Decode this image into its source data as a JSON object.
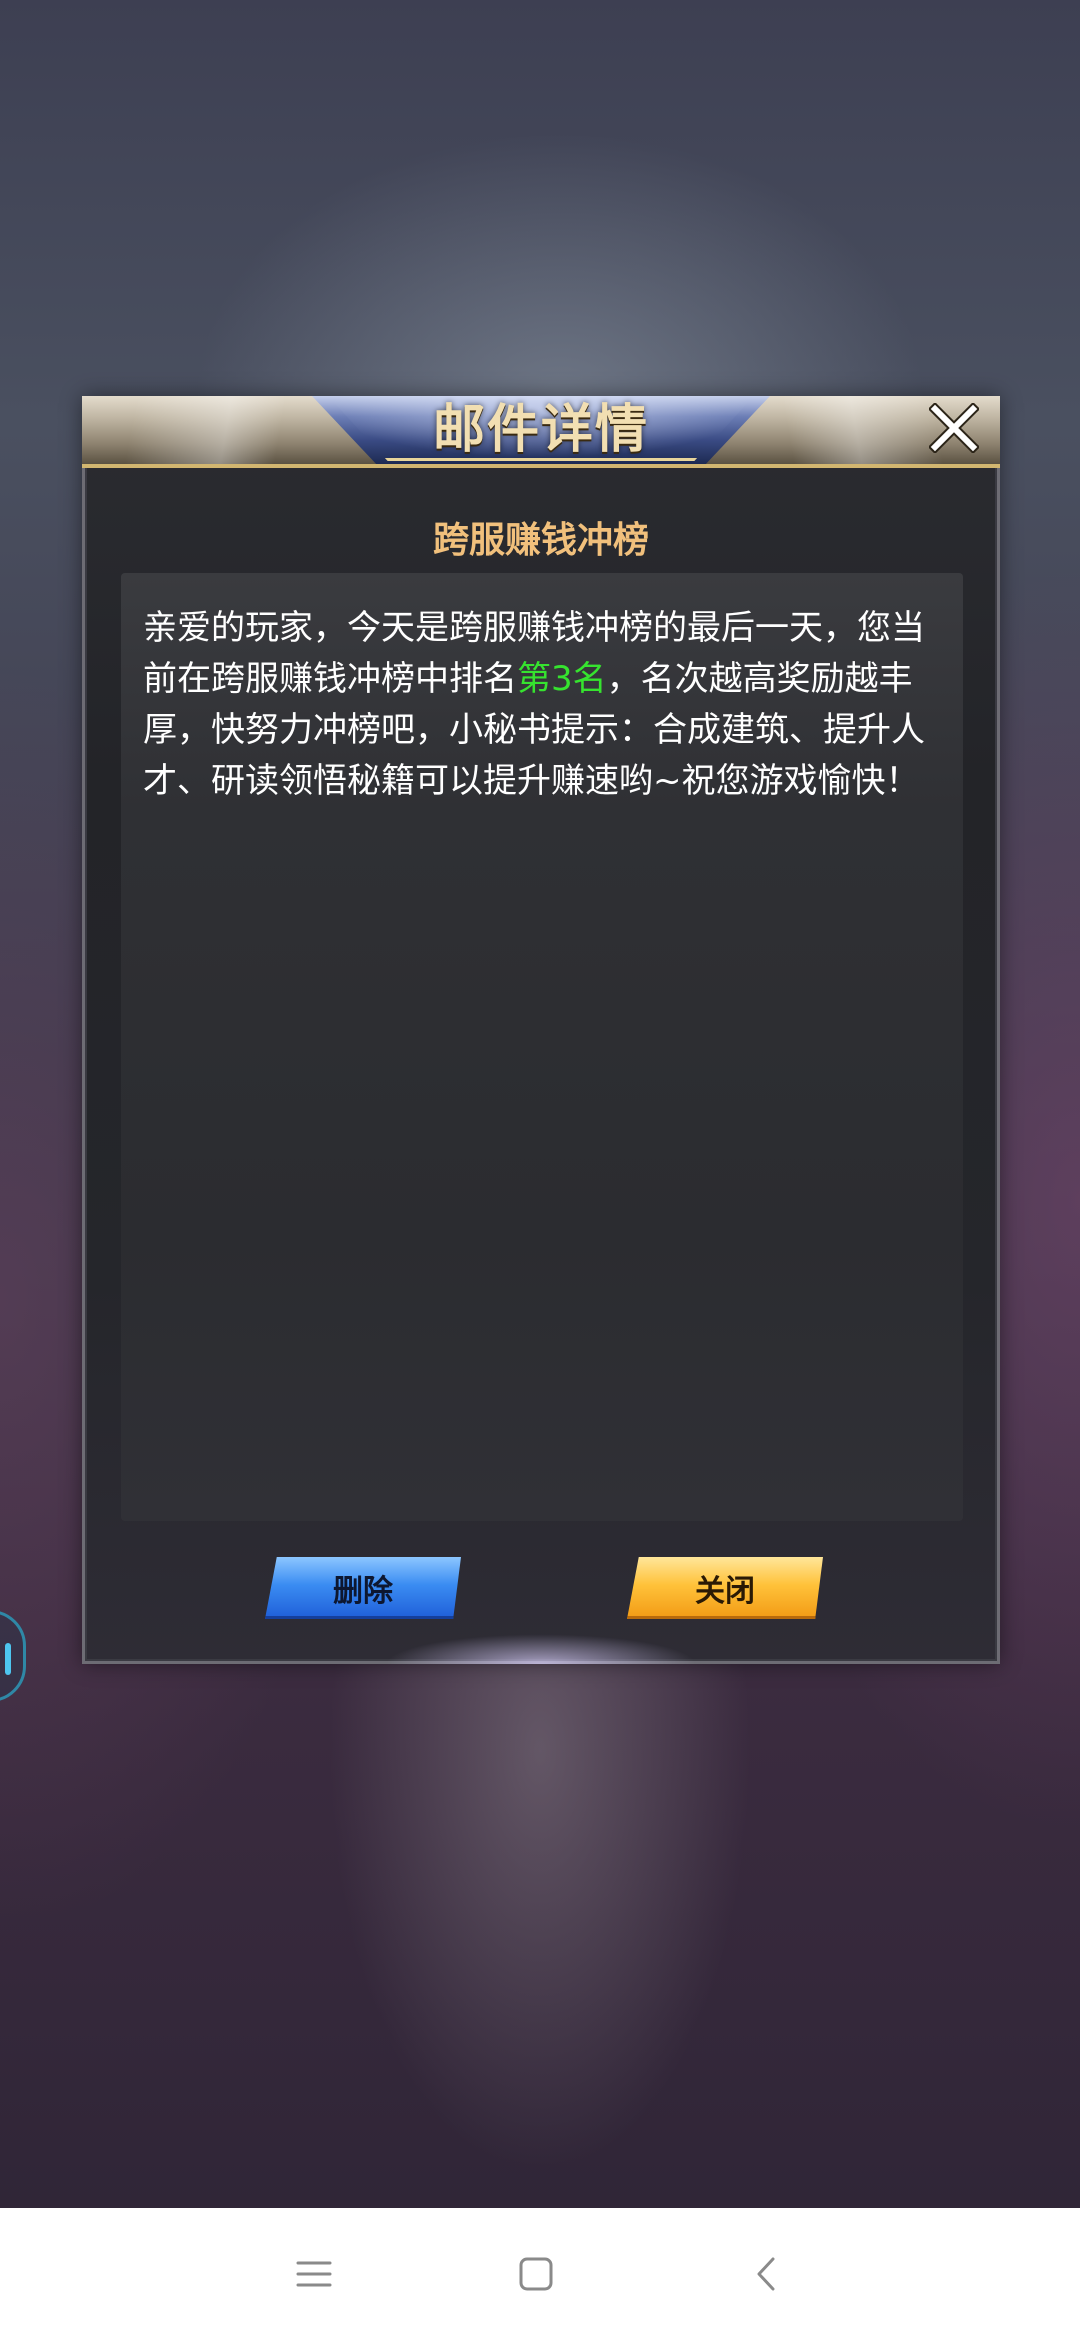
{
  "dialog": {
    "title": "邮件详情",
    "subject": "跨服赚钱冲榜",
    "body_part1": "亲爱的玩家，今天是跨服赚钱冲榜的最后一天，您当前在跨服赚钱冲榜中排名",
    "body_highlight": "第3名",
    "body_part2": "，名次越高奖励越丰厚，快努力冲榜吧，小秘书提示：合成建筑、提升人才、研读领悟秘籍可以提升赚速哟~祝您游戏愉快！",
    "delete_label": "删除",
    "close_label": "关闭"
  },
  "colors": {
    "title": "#f2dfb2",
    "subject": "#f1c07c",
    "highlight": "#36e32f",
    "delete_button": "#3a8cf2",
    "close_button": "#ffc23a"
  },
  "icons": {
    "close": "close-icon",
    "menu": "menu-icon",
    "home": "home-icon",
    "back": "back-icon"
  }
}
